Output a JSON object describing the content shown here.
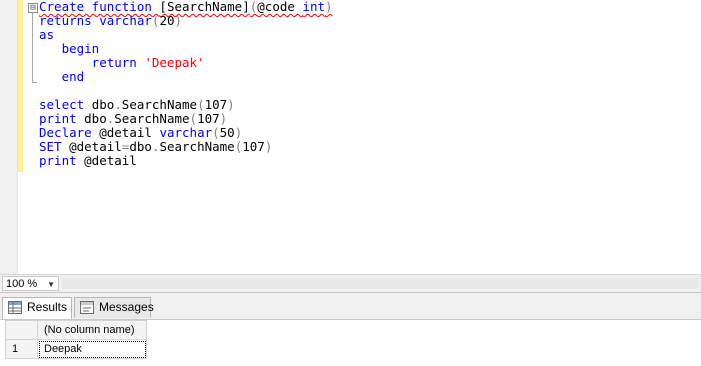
{
  "editor": {
    "collapse_glyph": "⊟",
    "lines": [
      [
        {
          "t": "Create function ",
          "c": "kw",
          "sq": true
        },
        {
          "t": "[SearchName]",
          "c": "pl",
          "sq": true
        },
        {
          "t": "(",
          "c": "op",
          "sq": true
        },
        {
          "t": "@code ",
          "c": "pl",
          "sq": true
        },
        {
          "t": "int",
          "c": "kw",
          "sq": true
        },
        {
          "t": ")",
          "c": "op",
          "sq": true
        }
      ],
      [
        {
          "t": "returns ",
          "c": "kw"
        },
        {
          "t": "varchar",
          "c": "kw"
        },
        {
          "t": "(",
          "c": "op"
        },
        {
          "t": "20",
          "c": "pl"
        },
        {
          "t": ")",
          "c": "op"
        }
      ],
      [
        {
          "t": "as",
          "c": "kw"
        }
      ],
      [
        {
          "t": "   begin",
          "c": "kw"
        }
      ],
      [
        {
          "t": "       return ",
          "c": "kw"
        },
        {
          "t": "'Deepak'",
          "c": "str"
        }
      ],
      [
        {
          "t": "   end",
          "c": "kw"
        }
      ],
      [
        {
          "t": "",
          "c": "pl"
        }
      ],
      [
        {
          "t": "select ",
          "c": "kw"
        },
        {
          "t": "dbo",
          "c": "pl"
        },
        {
          "t": ".",
          "c": "op"
        },
        {
          "t": "SearchName",
          "c": "pl"
        },
        {
          "t": "(",
          "c": "op"
        },
        {
          "t": "107",
          "c": "pl"
        },
        {
          "t": ")",
          "c": "op"
        }
      ],
      [
        {
          "t": "print ",
          "c": "kw"
        },
        {
          "t": "dbo",
          "c": "pl"
        },
        {
          "t": ".",
          "c": "op"
        },
        {
          "t": "SearchName",
          "c": "pl"
        },
        {
          "t": "(",
          "c": "op"
        },
        {
          "t": "107",
          "c": "pl"
        },
        {
          "t": ")",
          "c": "op"
        }
      ],
      [
        {
          "t": "Declare ",
          "c": "kw"
        },
        {
          "t": "@detail ",
          "c": "pl"
        },
        {
          "t": "varchar",
          "c": "kw"
        },
        {
          "t": "(",
          "c": "op"
        },
        {
          "t": "50",
          "c": "pl"
        },
        {
          "t": ")",
          "c": "op"
        }
      ],
      [
        {
          "t": "SET ",
          "c": "kw"
        },
        {
          "t": "@detail",
          "c": "pl"
        },
        {
          "t": "=",
          "c": "op"
        },
        {
          "t": "dbo",
          "c": "pl"
        },
        {
          "t": ".",
          "c": "op"
        },
        {
          "t": "SearchName",
          "c": "pl"
        },
        {
          "t": "(",
          "c": "op"
        },
        {
          "t": "107",
          "c": "pl"
        },
        {
          "t": ")",
          "c": "op"
        }
      ],
      [
        {
          "t": "print ",
          "c": "kw"
        },
        {
          "t": "@detail",
          "c": "pl"
        }
      ]
    ]
  },
  "zoom": {
    "value": "100 %",
    "arrow": "▼"
  },
  "tabs": {
    "results": "Results",
    "messages": "Messages"
  },
  "grid": {
    "header": "(No column name)",
    "rows": [
      {
        "num": "1",
        "value": "Deepak"
      }
    ]
  }
}
